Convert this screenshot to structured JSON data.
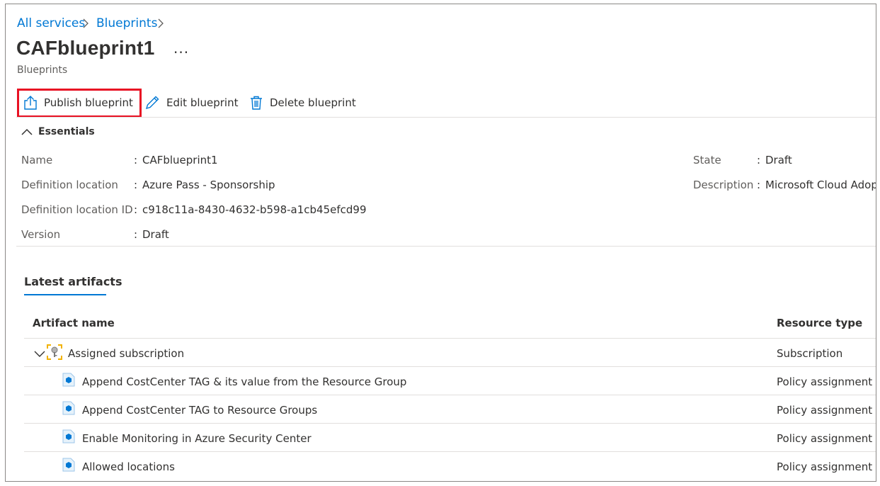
{
  "breadcrumb": {
    "items": [
      "All services",
      "Blueprints"
    ],
    "separator": ">"
  },
  "header": {
    "title": "CAFblueprint1",
    "more": "...",
    "subtitle": "Blueprints"
  },
  "toolbar": {
    "publish": "Publish blueprint",
    "edit": "Edit blueprint",
    "delete": "Delete blueprint"
  },
  "essentials": {
    "toggle_label": "Essentials",
    "colon": ":",
    "left": [
      {
        "label": "Name",
        "value": "CAFblueprint1"
      },
      {
        "label": "Definition location",
        "value": "Azure Pass - Sponsorship"
      },
      {
        "label": "Definition location ID",
        "value": "c918c11a-8430-4632-b598-a1cb45efcd99"
      },
      {
        "label": "Version",
        "value": "Draft"
      }
    ],
    "right": [
      {
        "label": "State",
        "value": "Draft"
      },
      {
        "label": "Description",
        "value": "Microsoft Cloud Adop"
      }
    ]
  },
  "artifacts": {
    "tab_label": "Latest artifacts",
    "columns": [
      "Artifact name",
      "Resource type"
    ],
    "group": {
      "name": "Assigned subscription",
      "type": "Subscription"
    },
    "rows": [
      {
        "name": "Append CostCenter TAG & its value from the Resource Group",
        "type": "Policy assignment"
      },
      {
        "name": "Append CostCenter TAG to Resource Groups",
        "type": "Policy assignment"
      },
      {
        "name": "Enable Monitoring in Azure Security Center",
        "type": "Policy assignment"
      },
      {
        "name": "Allowed locations",
        "type": "Policy assignment"
      }
    ]
  },
  "colors": {
    "link": "#0078d4",
    "highlight": "#e81123",
    "text": "#323130",
    "muted": "#605e5c"
  },
  "icons": [
    "chevron-right-icon",
    "publish-icon",
    "edit-icon",
    "delete-icon",
    "chevron-up-icon",
    "chevron-down-icon",
    "subscription-icon",
    "policy-icon"
  ]
}
